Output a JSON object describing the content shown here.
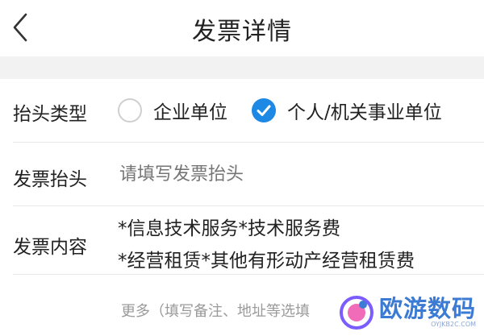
{
  "header": {
    "title": "发票详情",
    "back_icon": "chevron-left-icon"
  },
  "header_type": {
    "label": "抬头类型",
    "options": [
      {
        "label": "企业单位",
        "selected": false
      },
      {
        "label": "个人/机关事业单位",
        "selected": true
      }
    ]
  },
  "invoice_title": {
    "label": "发票抬头",
    "value": "",
    "placeholder": "请填写发票抬头"
  },
  "invoice_content": {
    "label": "发票内容",
    "lines": [
      "*信息技术服务*技术服务费",
      "*经营租赁*其他有形动产经营租赁费"
    ]
  },
  "more": {
    "text": "更多（填写备注、地址等选填"
  },
  "watermark": {
    "text": "欧游数码",
    "sub": "OYJKB2C.COM"
  },
  "colors": {
    "accent": "#1e88e5",
    "divider": "#e7e7e7",
    "section_gap": "#f2f2f2",
    "placeholder": "#b0b0b0"
  }
}
